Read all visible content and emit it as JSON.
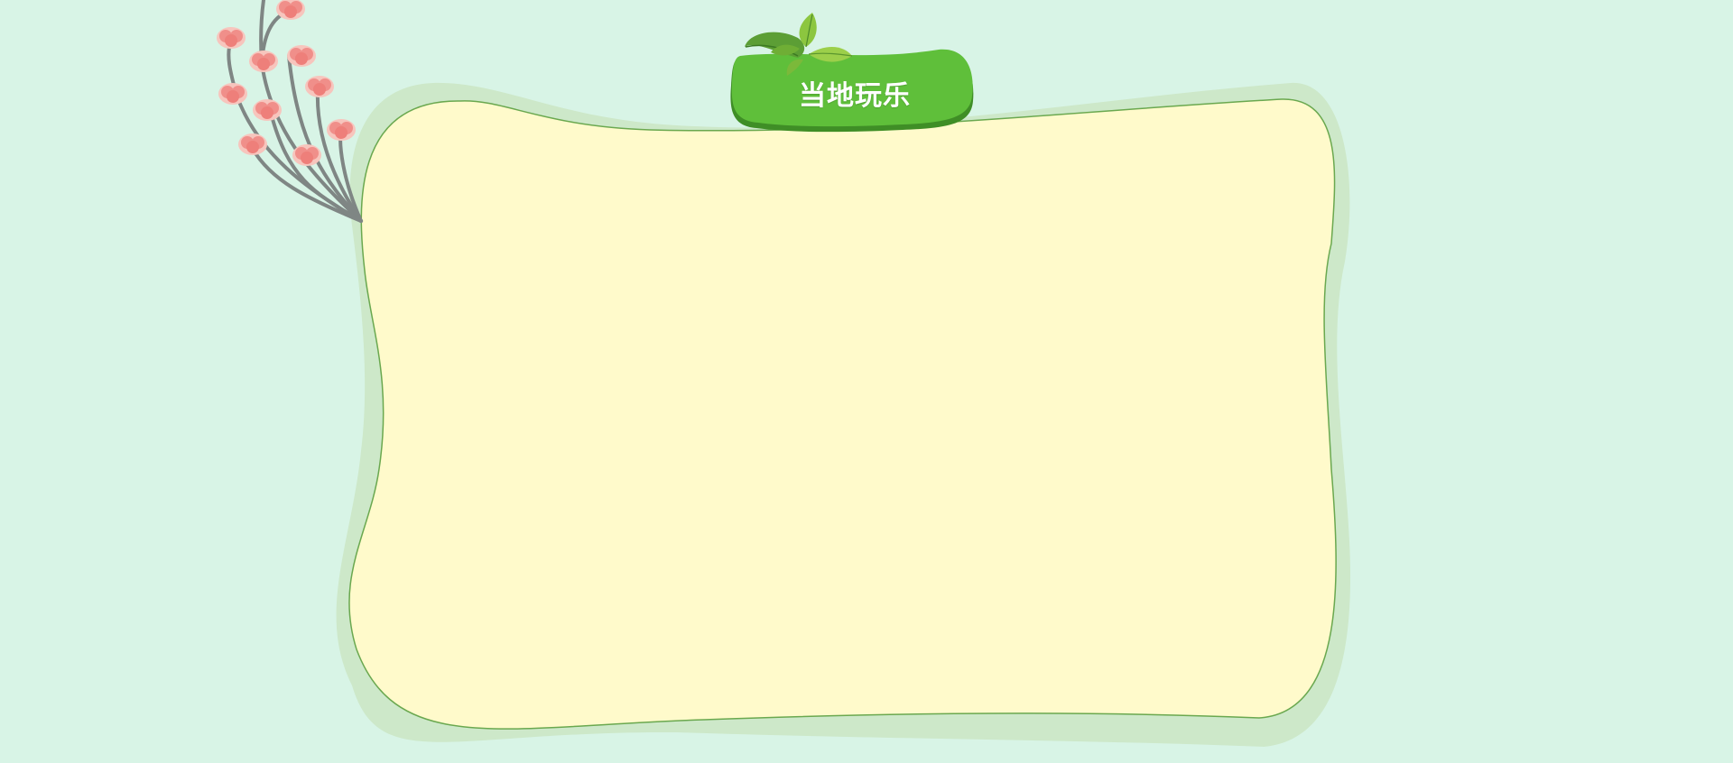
{
  "section": {
    "title": "当地玩乐"
  },
  "colors": {
    "page_background": "#d8f4e6",
    "card_shadow": "#cde8c9",
    "card_fill": "#fffacb",
    "card_outline": "#6aa84f",
    "tab_green": "#5fbf3a",
    "tab_green_dark": "#3f8e26",
    "flower_pink": "#f08f8a",
    "stem_gray": "#7f8684"
  },
  "icons": {
    "leaf": "mint-leaf-icon",
    "flower": "blossom-branch-icon"
  }
}
